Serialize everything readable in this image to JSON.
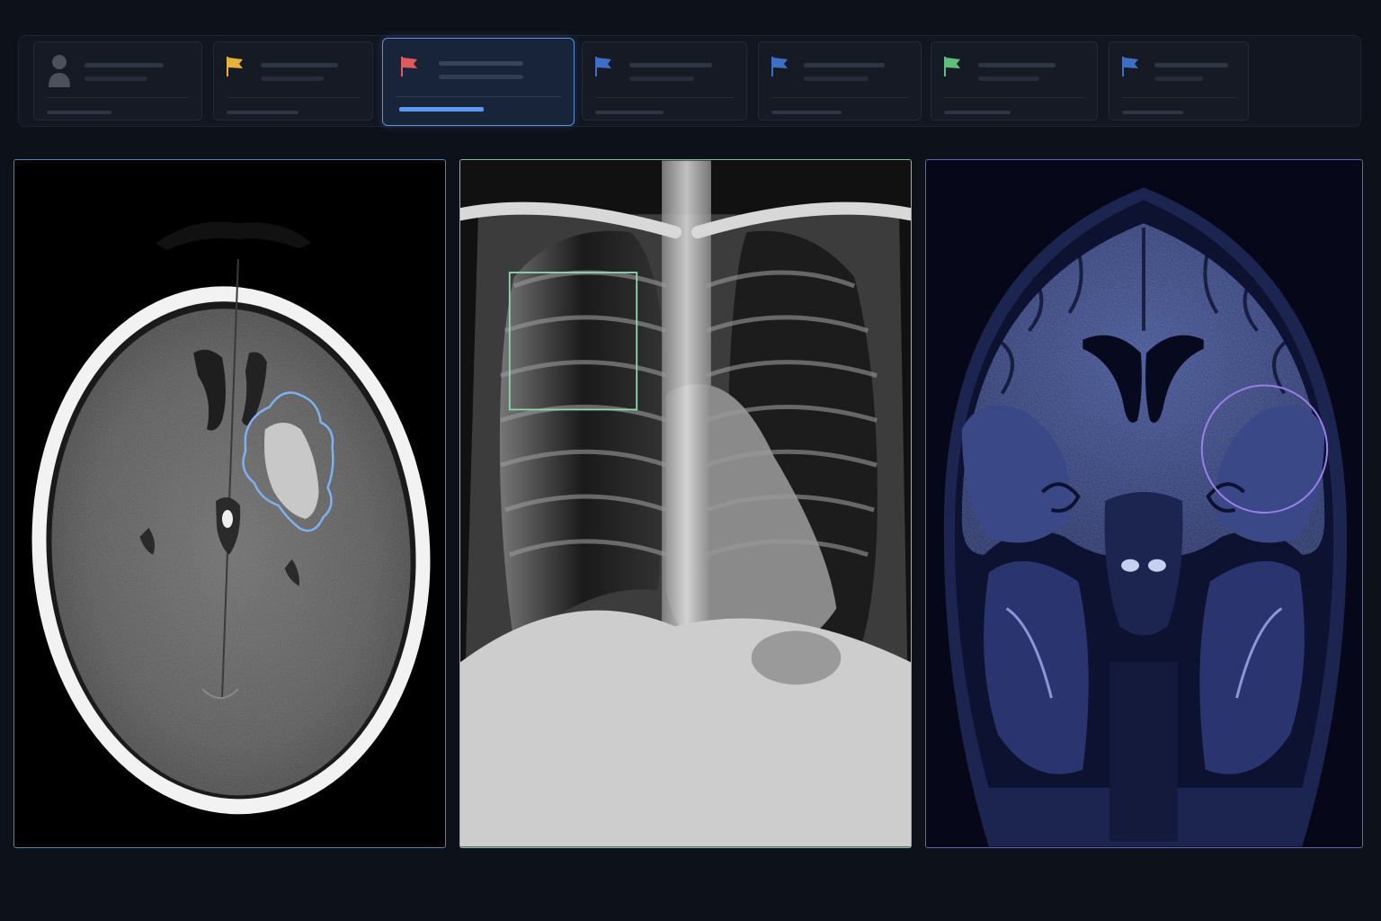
{
  "worklist": {
    "cards": [
      {
        "icon": "user-icon",
        "color": "#4a505c",
        "active": false
      },
      {
        "icon": "flag-icon",
        "color": "#e8b23a",
        "active": false
      },
      {
        "icon": "flag-icon",
        "color": "#e05a5a",
        "active": true
      },
      {
        "icon": "flag-icon",
        "color": "#3f6fc4",
        "active": false
      },
      {
        "icon": "flag-icon",
        "color": "#3f6fc4",
        "active": false
      },
      {
        "icon": "flag-icon",
        "color": "#5fbf7a",
        "active": false
      },
      {
        "icon": "flag-icon",
        "color": "#3f6fc4",
        "active": false
      }
    ]
  },
  "viewports": [
    {
      "modality": "ct-head-axial",
      "border_color": "#5a7fb8",
      "annotation": "freehand-contour",
      "annotation_color": "#7fb0f0"
    },
    {
      "modality": "chest-xray-pa",
      "border_color": "#7fbf9a",
      "annotation": "rectangle",
      "annotation_color": "#8fd9ae"
    },
    {
      "modality": "mri-brain-coronal",
      "border_color": "#6b5fb0",
      "annotation": "ellipse",
      "annotation_color": "#9a7fe8"
    }
  ]
}
